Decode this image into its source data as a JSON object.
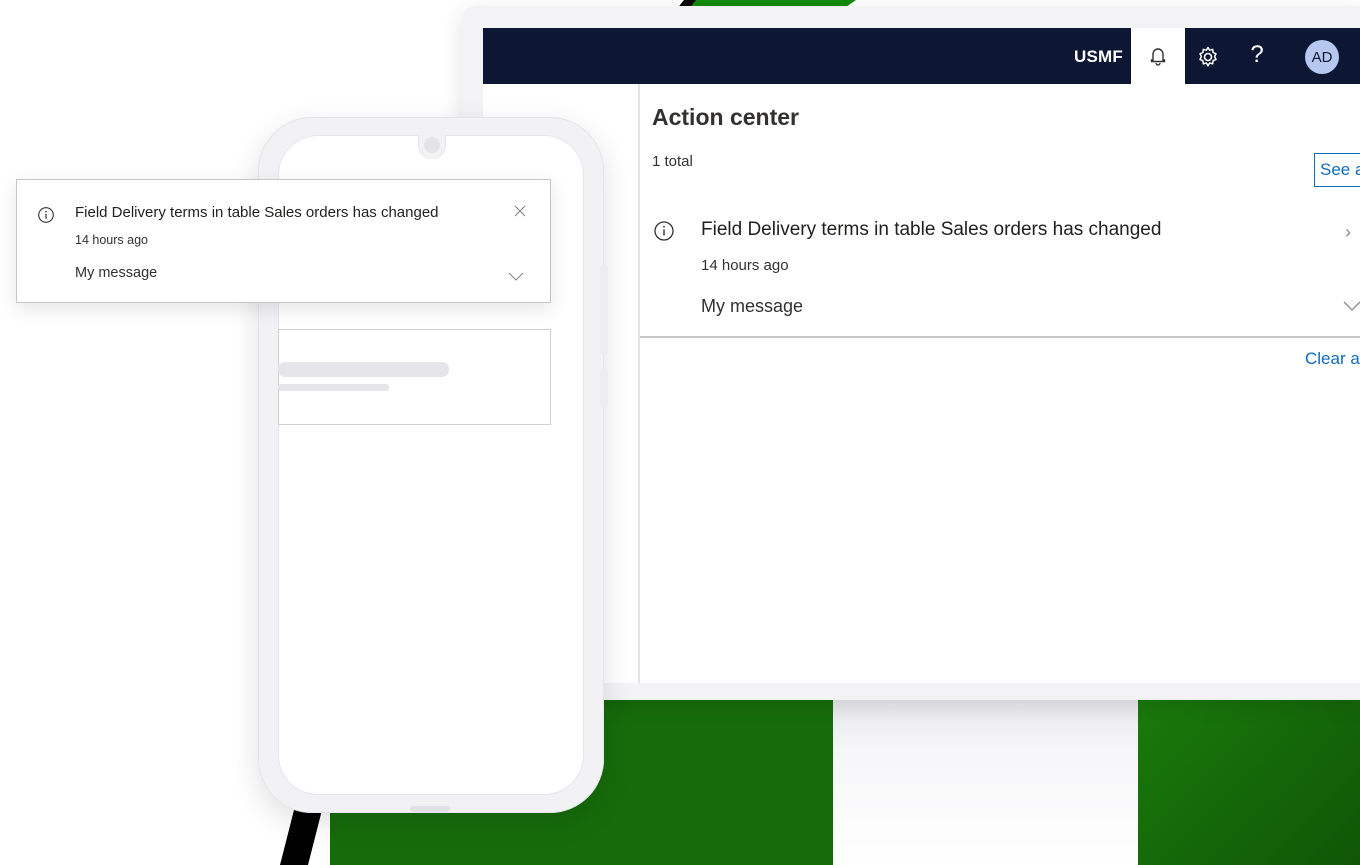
{
  "topbar": {
    "company": "USMF",
    "help_glyph": "?",
    "avatar_initials": "AD",
    "icons": [
      "bell-icon",
      "gear-icon",
      "help-icon"
    ]
  },
  "action_center": {
    "title": "Action center",
    "total": "1 total",
    "see_all_label": "See all",
    "clear_all_label": "Clear all",
    "items": [
      {
        "icon": "info-icon",
        "title": "Field Delivery terms in table Sales orders has changed",
        "time": "14 hours ago",
        "message": "My message"
      }
    ]
  },
  "toast": {
    "icon": "info-icon",
    "title": "Field Delivery terms in table Sales orders has changed",
    "time": "14 hours ago",
    "message": "My message"
  },
  "colors": {
    "topbar_bg": "#0d1733",
    "accent": "#0f6cbd",
    "brand_green": "#166c0a"
  }
}
